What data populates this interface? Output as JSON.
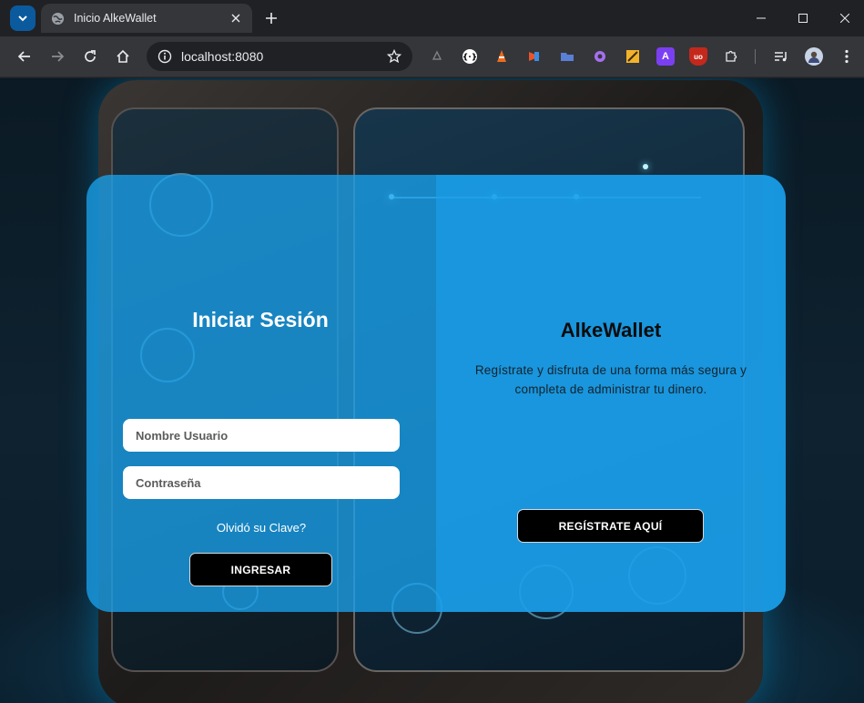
{
  "browser": {
    "tab_title": "Inicio AlkeWallet",
    "url": "localhost:8080",
    "icons": {
      "tab_search": "chevron-down-icon",
      "tab_favicon": "globe-icon",
      "tab_close": "close-icon",
      "new_tab": "plus-icon",
      "back": "arrow-left-icon",
      "forward": "arrow-right-icon",
      "reload": "reload-icon",
      "home": "home-icon",
      "site_info": "info-icon",
      "bookmark": "star-icon",
      "extensions": "puzzle-icon",
      "media": "media-queue-icon",
      "menu": "kebab-menu-icon"
    },
    "extensions": [
      "A",
      "uo"
    ]
  },
  "login": {
    "title": "Iniciar Sesión",
    "username_placeholder": "Nombre Usuario",
    "password_placeholder": "Contraseña",
    "forgot_label": "Olvidó su Clave?",
    "submit_label": "INGRESAR"
  },
  "brand": {
    "name": "AlkeWallet",
    "description": "Regístrate y disfruta de una forma más segura y completa de administrar tu dinero.",
    "register_label": "REGÍSTRATE AQUÍ"
  },
  "colors": {
    "card_blue": "#1aa0eb",
    "button_black": "#000000",
    "tab_search_blue": "#0b5a9e"
  }
}
